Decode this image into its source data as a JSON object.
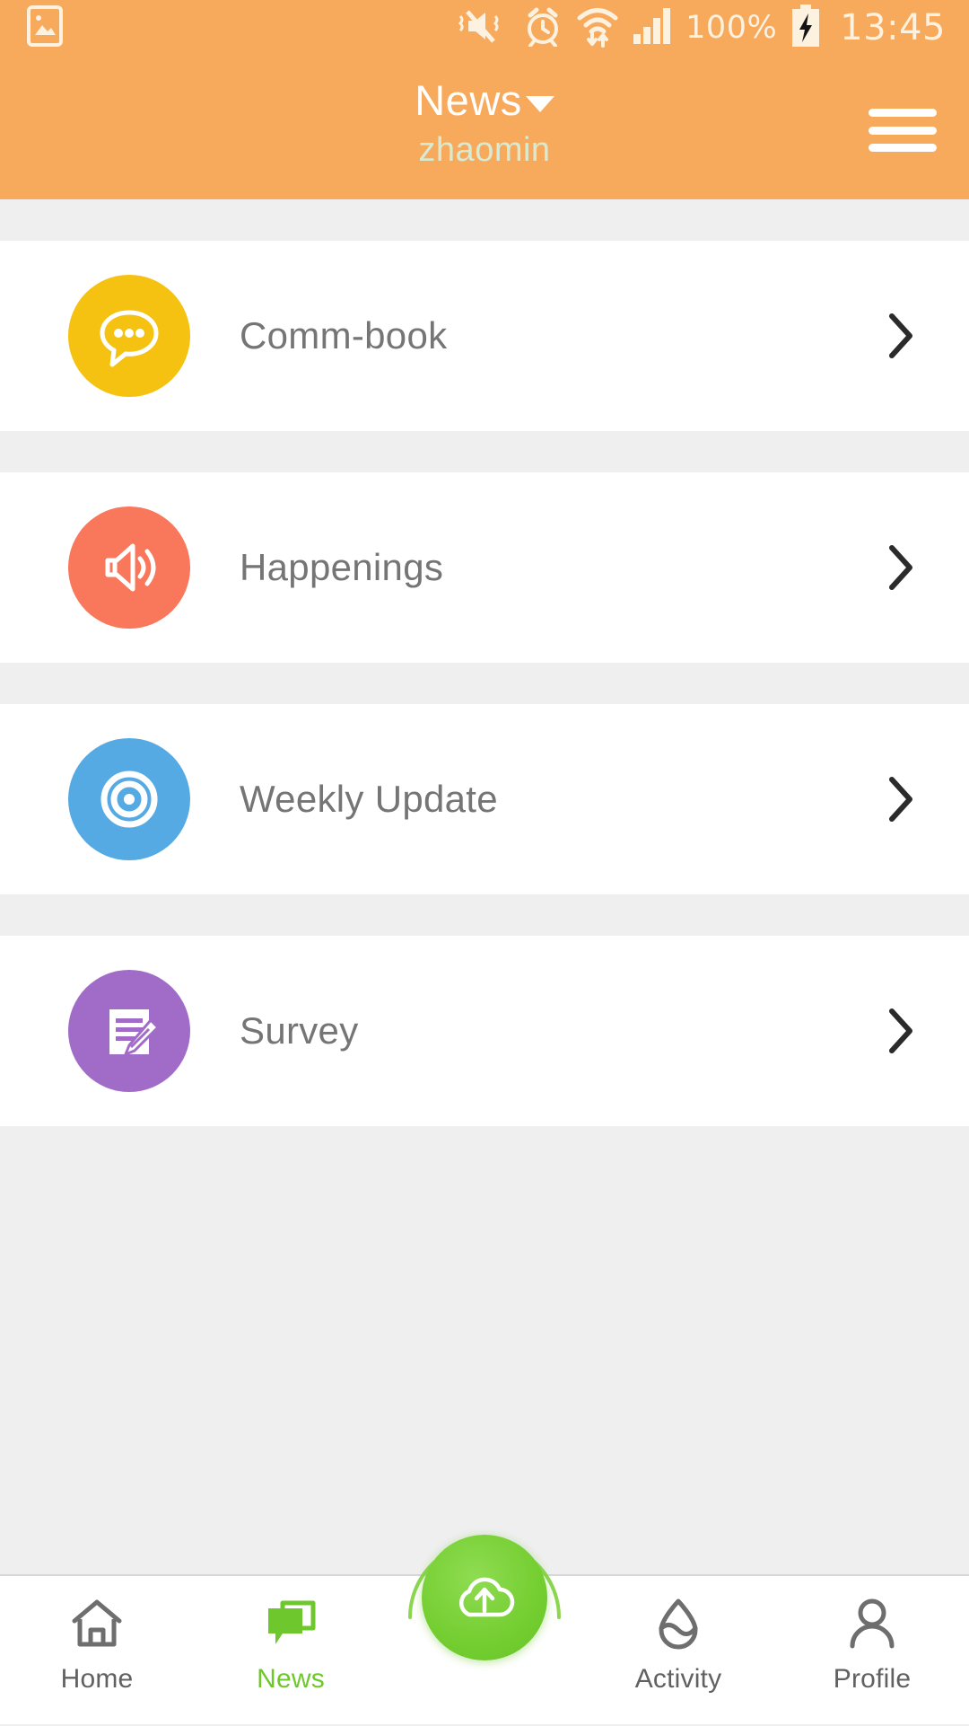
{
  "statusbar": {
    "screenshot_icon": "image-icon",
    "mute_vibrate_icon": "mute-vibrate-icon",
    "alarm_icon": "alarm-icon",
    "wifi_icon": "wifi-data-icon",
    "signal_icon": "signal-bars-icon",
    "battery_percent": "100%",
    "battery_icon": "battery-charging-icon",
    "time": "13:45"
  },
  "header": {
    "title": "News",
    "dropdown_icon": "chevron-down-icon",
    "subtitle": "zhaomin",
    "menu_icon": "hamburger-menu-icon",
    "background_color": "#f7a95c",
    "title_color": "#ffffff",
    "subtitle_color": "#d9ead3"
  },
  "list": {
    "items": [
      {
        "label": "Comm-book",
        "icon": "speech-bubble-dots-icon",
        "icon_color": "#f5c211",
        "chevron_icon": "chevron-right-icon"
      },
      {
        "label": "Happenings",
        "icon": "megaphone-speaker-icon",
        "icon_color": "#f9775a",
        "chevron_icon": "chevron-right-icon"
      },
      {
        "label": "Weekly Update",
        "icon": "target-bullseye-icon",
        "icon_color": "#56aae4",
        "chevron_icon": "chevron-right-icon"
      },
      {
        "label": "Survey",
        "icon": "document-pencil-icon",
        "icon_color": "#a06cc8",
        "chevron_icon": "chevron-right-icon"
      }
    ]
  },
  "bottomnav": {
    "active_color": "#6ec72d",
    "inactive_color": "#616161",
    "items": [
      {
        "label": "Home",
        "icon": "home-icon",
        "active": false
      },
      {
        "label": "News",
        "icon": "news-bubbles-icon",
        "active": true
      },
      {
        "label": "",
        "icon": "cloud-upload-icon",
        "active": false
      },
      {
        "label": "Activity",
        "icon": "water-drop-wave-icon",
        "active": false
      },
      {
        "label": "Profile",
        "icon": "person-icon",
        "active": false
      }
    ]
  }
}
